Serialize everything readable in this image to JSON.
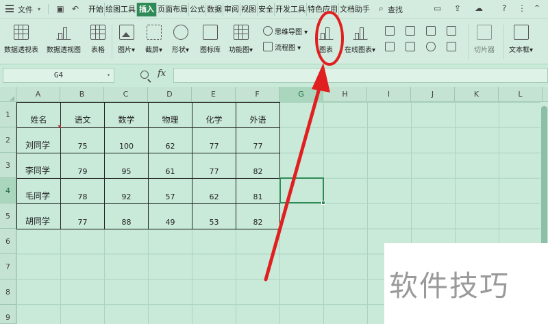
{
  "menubar": {
    "file_label": "文件",
    "tabs": [
      "开始",
      "绘图工具",
      "插入",
      "页面布局",
      "公式",
      "数据",
      "审阅",
      "视图",
      "安全",
      "开发工具",
      "特色应用",
      "文档助手"
    ],
    "active_tab_index": 2,
    "search_label": "查找"
  },
  "ribbon": {
    "pivot_table": "数据透视表",
    "pivot_chart": "数据透视图",
    "table": "表格",
    "picture": "图片",
    "screenshot": "截屏",
    "shape": "形状",
    "icon_library": "图标库",
    "function_chart": "功能图",
    "mind_map": "思维导图",
    "flowchart": "流程图",
    "chart": "图表",
    "online_chart": "在线图表",
    "slicer": "切片器",
    "textbox": "文本框"
  },
  "formula_bar": {
    "name_box": "G4",
    "fx_label": "fx",
    "formula": ""
  },
  "grid": {
    "columns": [
      "A",
      "B",
      "C",
      "D",
      "E",
      "F",
      "G",
      "H",
      "I",
      "J",
      "K",
      "L"
    ],
    "rows": [
      "1",
      "2",
      "3",
      "4",
      "5",
      "6",
      "7",
      "8",
      "9"
    ],
    "selected_col": "G",
    "selected_row": "4"
  },
  "table": {
    "header": [
      "姓名",
      "语文",
      "数学",
      "物理",
      "化学",
      "外语"
    ],
    "rows": [
      [
        "刘同学",
        "75",
        "100",
        "62",
        "77",
        "77"
      ],
      [
        "李同学",
        "79",
        "95",
        "61",
        "77",
        "82"
      ],
      [
        "毛同学",
        "78",
        "92",
        "57",
        "62",
        "81"
      ],
      [
        "胡同学",
        "77",
        "88",
        "49",
        "53",
        "82"
      ]
    ]
  },
  "watermark": {
    "text": "软件技巧"
  },
  "colors": {
    "accent": "#2e8b57",
    "annotation": "#e02020",
    "sheet_bg": "#c9e9d9"
  }
}
